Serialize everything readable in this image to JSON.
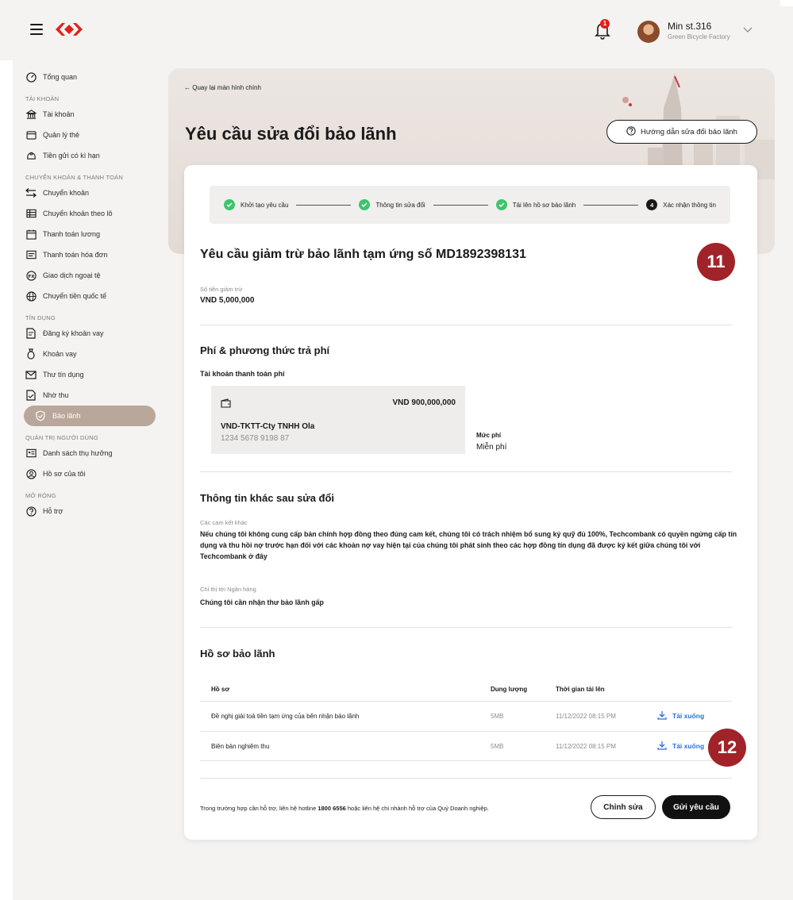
{
  "header": {
    "user_name": "Min st.316",
    "user_company": "Green Bicycle Factory",
    "notification_count": "1"
  },
  "sidebar": {
    "overview": "Tổng quan",
    "section_accounts": "TÀI KHOẢN",
    "accounts": [
      "Tài khoản",
      "Quản lý thẻ",
      "Tiền gửi có kì hạn"
    ],
    "section_transfers": "CHUYỂN KHOẢN & THANH TOÁN",
    "transfers": [
      "Chuyển khoản",
      "Chuyển khoản theo lô",
      "Thanh toán lương",
      "Thanh toán hóa đơn",
      "Giao dịch ngoại tệ",
      "Chuyển tiền quốc tế"
    ],
    "section_credit": "TÍN DỤNG",
    "credit": [
      "Đăng ký khoản vay",
      "Khoản vay",
      "Thư tín dụng",
      "Nhờ thu",
      "Bảo lãnh"
    ],
    "section_users": "QUẢN TRỊ NGƯỜI DÙNG",
    "users": [
      "Danh sách thụ hưởng",
      "Hồ sơ của tôi"
    ],
    "section_more": "MỞ RỘNG",
    "more": [
      "Hỗ trợ"
    ]
  },
  "hero": {
    "back_link": "Quay lại màn hình chính",
    "title": "Yêu cầu sửa đổi bảo lãnh",
    "guide_button": "Hướng dẫn sửa đổi bảo lãnh"
  },
  "stepper": {
    "steps": [
      "Khởi tạo yêu cầu",
      "Thông tin sửa đổi",
      "Tải lên hồ sơ bảo lãnh",
      "Xác nhận thông tin"
    ],
    "current_step_number": "4"
  },
  "request": {
    "title": "Yêu cầu giảm trừ bảo lãnh tạm ứng số MD1892398131",
    "amount_label": "Số tiền giảm trừ",
    "amount_value": "VND 5,000,000"
  },
  "fee": {
    "title": "Phí & phương thức trả phí",
    "account_label": "Tài khoản thanh toán phí",
    "account_balance": "VND 900,000,000",
    "account_name": "VND-TKTT-Cty TNHH Ola",
    "account_number": "1234 5678 9198 87",
    "fee_label": "Mức phí",
    "fee_value": "Miễn phí"
  },
  "other_info": {
    "title": "Thông tin khác sau sửa đổi",
    "commitments_label": "Các cam kết khác",
    "commitments_text": "Nếu chúng tôi không cung cấp bản chính hợp đồng theo đúng cam kết, chúng tôi có trách nhiệm bổ sung ký quỹ đủ 100%, Techcombank có quyền ngừng cấp tín dụng và thu hồi nợ trước hạn đối với các khoản nợ vay hiện tại của chúng tôi phát sinh theo các hợp đồng tín dụng đã được ký kết giữa chúng tôi với Techcombank ở đây",
    "bank_instruction_label": "Chỉ thị tới Ngân hàng",
    "bank_instruction_text": "Chúng tôi cần nhận thư bảo lãnh gấp"
  },
  "documents": {
    "title": "Hồ sơ bảo lãnh",
    "columns": [
      "Hồ sơ",
      "Dung lượng",
      "Thời gian tải lên"
    ],
    "rows": [
      {
        "name": "Đề nghị giải toả tiền tạm ứng của bên nhận bảo lãnh",
        "size": "5MB",
        "time": "11/12/2022 08:15 PM",
        "action": "Tải xuống"
      },
      {
        "name": "Biên bản nghiệm thu",
        "size": "5MB",
        "time": "11/12/2022 08:15 PM",
        "action": "Tải xuống"
      }
    ]
  },
  "footer": {
    "note_prefix": "Trong trường hợp cần hỗ trợ, liên hệ hotline ",
    "hotline": "1800 6556",
    "note_suffix": " hoặc liên hệ chi nhánh hỗ trợ của Quý Doanh nghiệp.",
    "edit_button": "Chỉnh sửa",
    "send_button": "Gửi yêu cầu"
  },
  "annotations": {
    "badge_a": "11",
    "badge_b": "12"
  },
  "colors": {
    "brand_red": "#e0201b",
    "active_sidebar": "#b8a79a",
    "success_green": "#3ec46d",
    "link_blue": "#2f6fd6",
    "badge_red": "#a1232a"
  }
}
